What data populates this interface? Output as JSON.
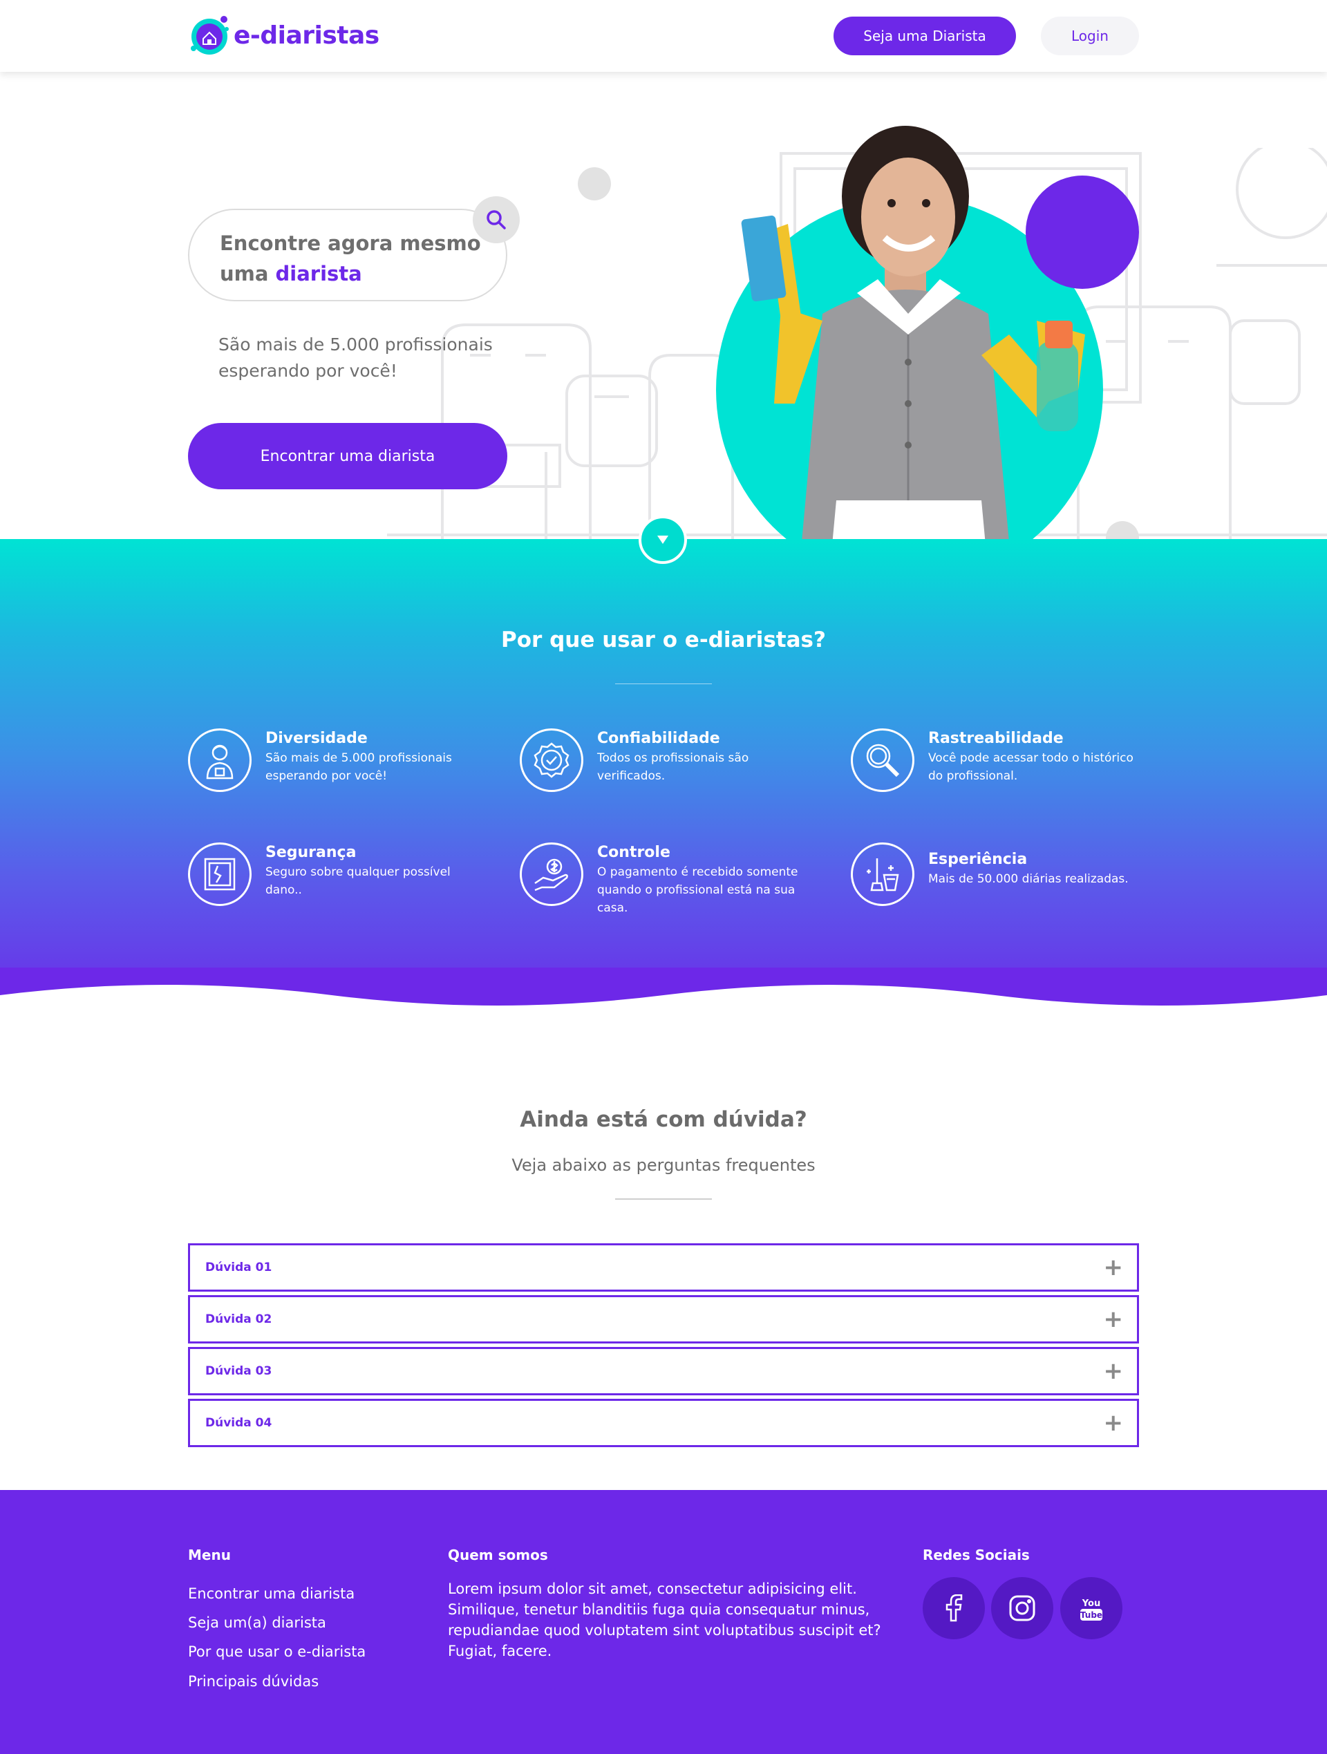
{
  "header": {
    "brand": "e-diaristas",
    "primary_button": "Seja uma Diarista",
    "login_button": "Login"
  },
  "hero": {
    "search_line1": "Encontre agora mesmo",
    "search_line2_prefix": "uma ",
    "search_line2_accent": "diarista",
    "subtitle": "São mais de 5.000 profissionais esperando por você!",
    "cta": "Encontrar uma diarista"
  },
  "features": {
    "title": "Por que usar o e-diaristas?",
    "items": [
      {
        "title": "Diversidade",
        "desc": "São mais de 5.000 profissionais esperando por você!",
        "icon": "worker-icon"
      },
      {
        "title": "Confiabilidade",
        "desc": "Todos os profissionais são verificados.",
        "icon": "verified-badge-icon"
      },
      {
        "title": "Rastreabilidade",
        "desc": "Você pode acessar todo o histórico do profissional.",
        "icon": "magnifier-icon"
      },
      {
        "title": "Segurança",
        "desc": "Seguro sobre qualquer possível dano..",
        "icon": "broken-frame-icon"
      },
      {
        "title": "Controle",
        "desc": "O pagamento é recebido somente quando o profissional está na sua casa.",
        "icon": "payment-hand-icon"
      },
      {
        "title": "Esperiência",
        "desc": "Mais de 50.000 diárias realizadas.",
        "icon": "cleaning-bucket-icon"
      }
    ]
  },
  "faq": {
    "title": "Ainda está com dúvida?",
    "subtitle": "Veja abaixo as perguntas frequentes",
    "items": [
      "Dúvida 01",
      "Dúvida 02",
      "Dúvida 03",
      "Dúvida 04"
    ],
    "expand_symbol": "+"
  },
  "footer": {
    "menu_title": "Menu",
    "menu_links": [
      "Encontrar uma diarista",
      "Seja um(a) diarista",
      "Por que usar o e-diarista",
      "Principais dúvidas"
    ],
    "about_title": "Quem somos",
    "about_text": "Lorem ipsum dolor sit amet, consectetur adipisicing elit. Similique, tenetur blanditiis fuga quia consequatur minus, repudiandae quod voluptatem sint voluptatibus suscipit et? Fugiat, facere.",
    "social_title": "Redes Sociais",
    "socials": [
      "facebook-icon",
      "instagram-icon",
      "youtube-icon"
    ],
    "youtube_text_top": "You",
    "youtube_text_bottom": "Tube"
  },
  "colors": {
    "brand_purple": "#6d28e8",
    "teal": "#00e3d4",
    "text_gray": "#6b6b6b"
  }
}
